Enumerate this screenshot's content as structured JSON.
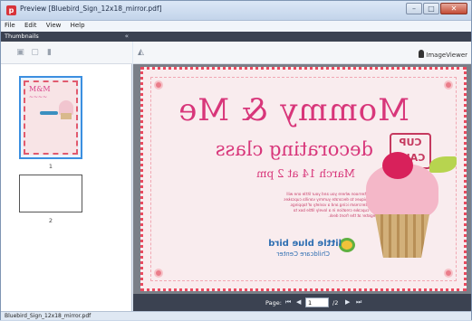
{
  "window": {
    "title": "Preview [Bluebird_Sign_12x18_mirror.pdf]",
    "controls": {
      "minimize": "–",
      "maximize": "□",
      "close": "✕"
    }
  },
  "menu": [
    "File",
    "Edit",
    "View",
    "Help"
  ],
  "thumbnails_panel": {
    "title": "Thumbnails",
    "collapse_glyph": "«",
    "tools": [
      "save-icon",
      "page-icon",
      "trash-icon"
    ],
    "pages": [
      {
        "number": "1"
      },
      {
        "number": "2"
      }
    ]
  },
  "viewer": {
    "brand": "ImageViewer"
  },
  "document": {
    "headline": "Mommy & Me",
    "subheadline": "decorating class",
    "badge_line1": "CUP",
    "badge_line2": "CAKE",
    "date": "March 14 at 2 pm",
    "body": "Join us for a fun afternoon where you and your little one will learn simple techniques to decorate yummy vanilla cupcakes with delicious buttercream icing and a variety of toppings. Take home your cupcake creation in a lovely little box to share later. Register at the front desk.",
    "brand_name": "little blue bird",
    "brand_sub": "Childcare Center"
  },
  "pager": {
    "label": "Page:",
    "first": "⏮",
    "prev": "◀",
    "current": "1",
    "of": "/2",
    "next": "▶",
    "last": "⏭"
  },
  "status": {
    "filename": "Bluebird_Sign_12x18_mirror.pdf"
  }
}
